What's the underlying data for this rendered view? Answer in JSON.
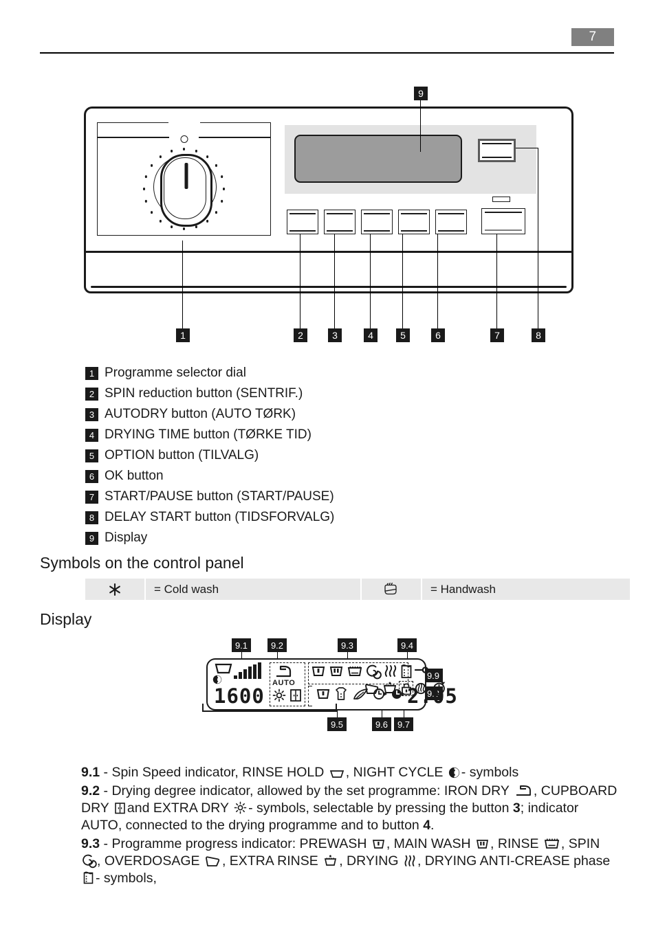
{
  "page": {
    "number": "7"
  },
  "panel_callouts": [
    {
      "id": "1",
      "label": "1"
    },
    {
      "id": "2",
      "label": "2"
    },
    {
      "id": "3",
      "label": "3"
    },
    {
      "id": "4",
      "label": "4"
    },
    {
      "id": "5",
      "label": "5"
    },
    {
      "id": "6",
      "label": "6"
    },
    {
      "id": "7",
      "label": "7"
    },
    {
      "id": "8",
      "label": "8"
    },
    {
      "id": "9",
      "label": "9"
    }
  ],
  "legend": {
    "items": [
      {
        "num": "1",
        "text": "Programme selector dial"
      },
      {
        "num": "2",
        "text": "SPIN reduction button (SENTRIF.)"
      },
      {
        "num": "3",
        "text": "AUTODRY button (AUTO TØRK)"
      },
      {
        "num": "4",
        "text": "DRYING TIME button (TØRKE TID)"
      },
      {
        "num": "5",
        "text": "OPTION button (TILVALG)"
      },
      {
        "num": "6",
        "text": "OK button"
      },
      {
        "num": "7",
        "text": "START/PAUSE button (START/PAUSE)"
      },
      {
        "num": "8",
        "text": "DELAY START button (TIDSFORVALG)"
      },
      {
        "num": "9",
        "text": "Display"
      }
    ]
  },
  "headings": {
    "symbols": "Symbols on the control panel",
    "display": "Display"
  },
  "symbols_table": {
    "rows": [
      {
        "icon": "asterisk-cold-wash-icon",
        "text": "= Cold wash"
      },
      {
        "icon": "hand-wash-icon",
        "text": "= Handwash"
      }
    ]
  },
  "display_diagram": {
    "callouts": [
      {
        "id": "9.1",
        "label": "9.1"
      },
      {
        "id": "9.2",
        "label": "9.2"
      },
      {
        "id": "9.3",
        "label": "9.3"
      },
      {
        "id": "9.4",
        "label": "9.4"
      },
      {
        "id": "9.5",
        "label": "9.5"
      },
      {
        "id": "9.6",
        "label": "9.6"
      },
      {
        "id": "9.7",
        "label": "9.7"
      },
      {
        "id": "9.8",
        "label": "9.8"
      },
      {
        "id": "9.9",
        "label": "9.9"
      }
    ],
    "spin_speed_value": "1600",
    "time_value": "2.05",
    "auto_label": "AUTO",
    "spin_bars": 6
  },
  "descriptions": {
    "d91": {
      "num": "9.1",
      "part1": "- Spin Speed indicator, RINSE HOLD",
      "part2": ", NIGHT CYCLE",
      "part3": "- symbols"
    },
    "d92": {
      "num": "9.2",
      "part1": "- Drying degree indicator, allowed by the set programme: IRON DRY",
      "part2": ", CUPBOARD DRY",
      "part3": "and EXTRA DRY",
      "part4": "- symbols, selectable by pressing the button",
      "ref1": "3",
      "part5": "; indicator AUTO, connected to the drying programme and to button",
      "ref2": "4",
      "part6": "."
    },
    "d93": {
      "num": "9.3",
      "part1": "- Programme progress indicator: PREWASH",
      "part2": ", MAIN WASH",
      "part3": ", RINSE",
      "part4": ", SPIN",
      "part5": ", OVERDOSAGE",
      "part6": ", EXTRA RINSE",
      "part7": ", DRYING",
      "part8": ", DRYING ANTI-CREASE phase",
      "part9": "-",
      "part10": "symbols,"
    }
  },
  "colors": {
    "ink": "#1a1a1a",
    "pagenum_bg": "#808080",
    "table_cell": "#e8e8e8",
    "display_zone": "#e3e3e3",
    "lcd_fill": "#9c9c9c"
  }
}
